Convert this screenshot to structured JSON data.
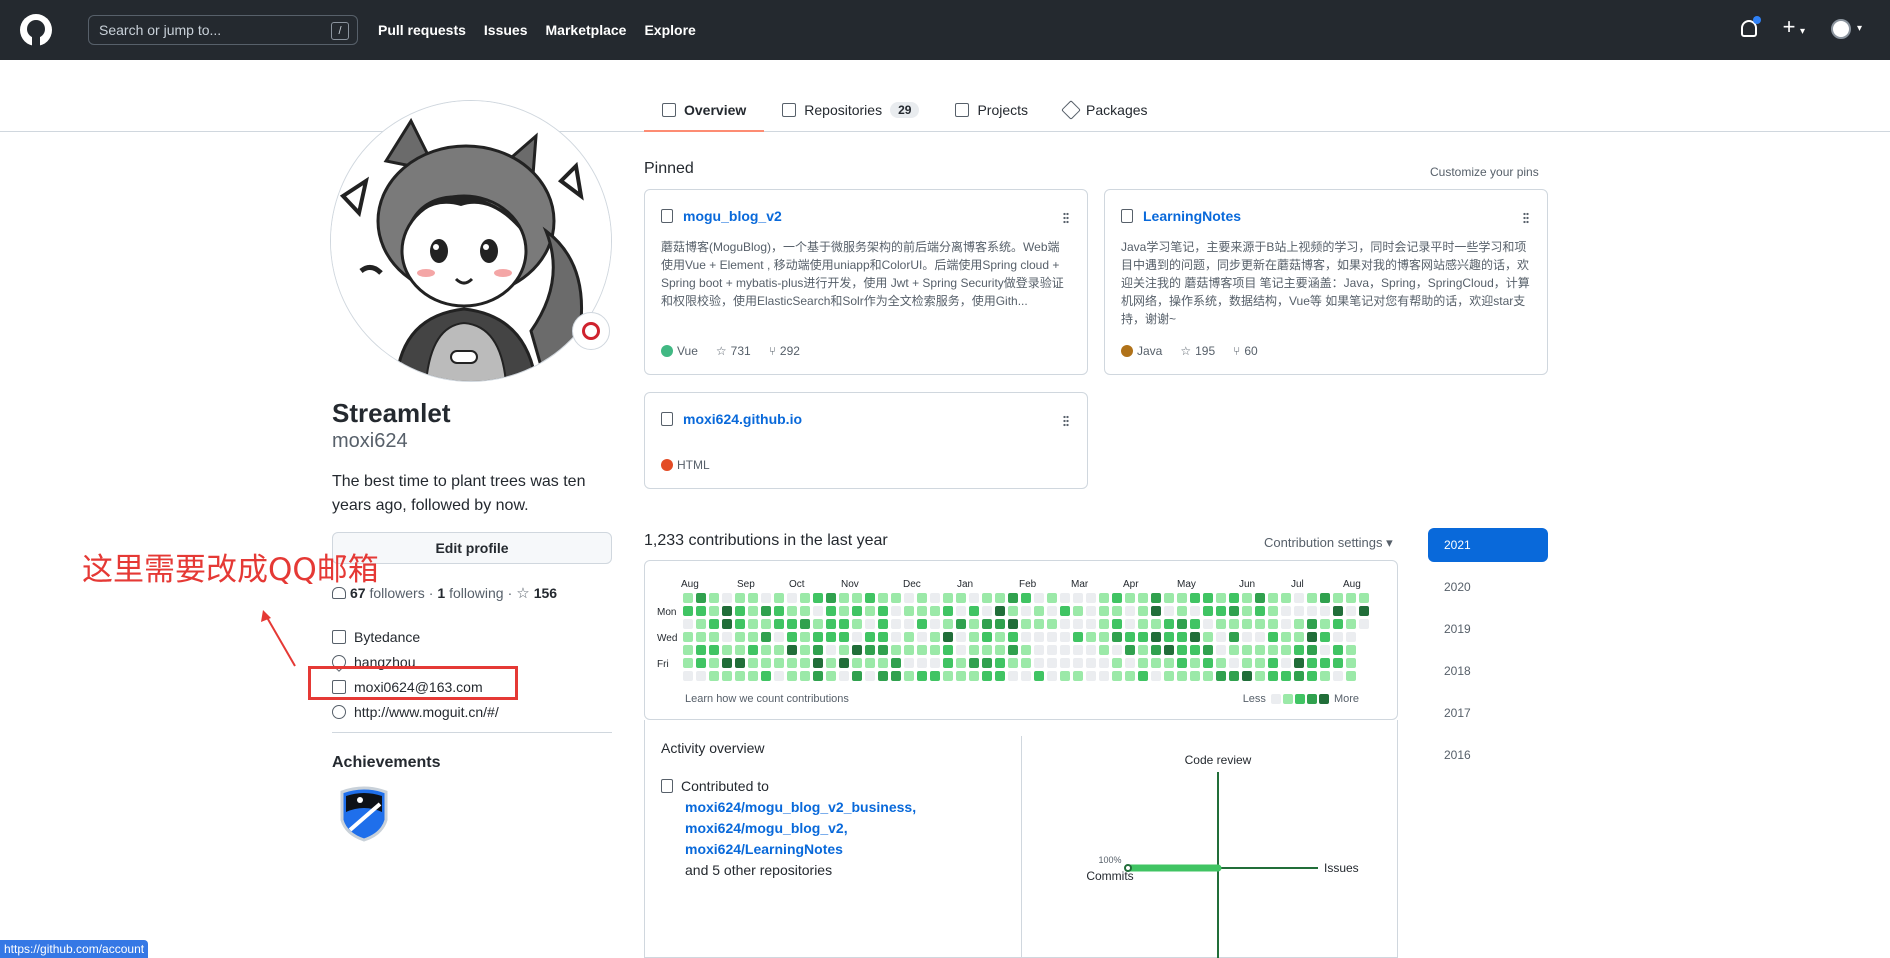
{
  "header": {
    "search_placeholder": "Search or jump to...",
    "slash": "/",
    "nav": [
      "Pull requests",
      "Issues",
      "Marketplace",
      "Explore"
    ],
    "plus": "+",
    "caret": "▾"
  },
  "tabs": [
    {
      "label": "Overview"
    },
    {
      "label": "Repositories",
      "count": "29"
    },
    {
      "label": "Projects"
    },
    {
      "label": "Packages"
    }
  ],
  "profile": {
    "name": "Streamlet",
    "login": "moxi624",
    "bio": "The best time to plant trees was ten years ago, followed by now.",
    "edit_button": "Edit profile",
    "followers_count": "67",
    "followers_label": "followers",
    "dot": "·",
    "following_count": "1",
    "following_label": "following",
    "stars": "156",
    "company": "Bytedance",
    "location": "hangzhou",
    "email": "moxi0624@163.com",
    "website": "http://www.moguit.cn/#/",
    "achievements_title": "Achievements"
  },
  "annotation": {
    "text": "这里需要改成QQ邮箱",
    "color": "#e53935"
  },
  "pinned": {
    "title": "Pinned",
    "customize": "Customize your pins",
    "repos": [
      {
        "name": "mogu_blog_v2",
        "desc": "蘑菇博客(MoguBlog)，一个基于微服务架构的前后端分离博客系统。Web端使用Vue + Element , 移动端使用uniapp和ColorUI。后端使用Spring cloud + Spring boot + mybatis-plus进行开发，使用 Jwt + Spring Security做登录验证和权限校验，使用ElasticSearch和Solr作为全文检索服务，使用Gith...",
        "lang": "Vue",
        "lang_color": "#41b883",
        "stars": "731",
        "forks": "292"
      },
      {
        "name": "LearningNotes",
        "desc": "Java学习笔记，主要来源于B站上视频的学习，同时会记录平时一些学习和项目中遇到的问题，同步更新在蘑菇博客，如果对我的博客网站感兴趣的话，欢迎关注我的 蘑菇博客项目 笔记主要涵盖：Java，Spring，SpringCloud，计算机网络，操作系统，数据结构，Vue等 如果笔记对您有帮助的话，欢迎star支持，谢谢~",
        "lang": "Java",
        "lang_color": "#b07219",
        "stars": "195",
        "forks": "60"
      },
      {
        "name": "moxi624.github.io",
        "desc": "",
        "lang": "HTML",
        "lang_color": "#e34c26",
        "stars": "",
        "forks": ""
      }
    ]
  },
  "contributions": {
    "title": "1,233 contributions in the last year",
    "settings": "Contribution settings ▾",
    "months": [
      "Aug",
      "Sep",
      "Oct",
      "Nov",
      "Dec",
      "Jan",
      "Feb",
      "Mar",
      "Apr",
      "May",
      "Jun",
      "Jul",
      "Aug"
    ],
    "days": [
      "Mon",
      "Wed",
      "Fri"
    ],
    "learn": "Learn how we count contributions",
    "less": "Less",
    "more": "More",
    "colors": [
      "#ebedf0",
      "#9be9a8",
      "#40c463",
      "#30a14e",
      "#216e39"
    ]
  },
  "years": [
    "2021",
    "2020",
    "2019",
    "2018",
    "2017",
    "2016"
  ],
  "activity": {
    "title": "Activity overview",
    "contributed_to": "Contributed to",
    "repos": [
      "moxi624/mogu_blog_v2_business,",
      "moxi624/mogu_blog_v2,",
      "moxi624/LearningNotes"
    ],
    "others": "and 5 other repositories",
    "code_review": "Code review",
    "issues": "Issues",
    "commits_pct": "100%",
    "commits": "Commits"
  },
  "status_bar": "https://github.com/account"
}
